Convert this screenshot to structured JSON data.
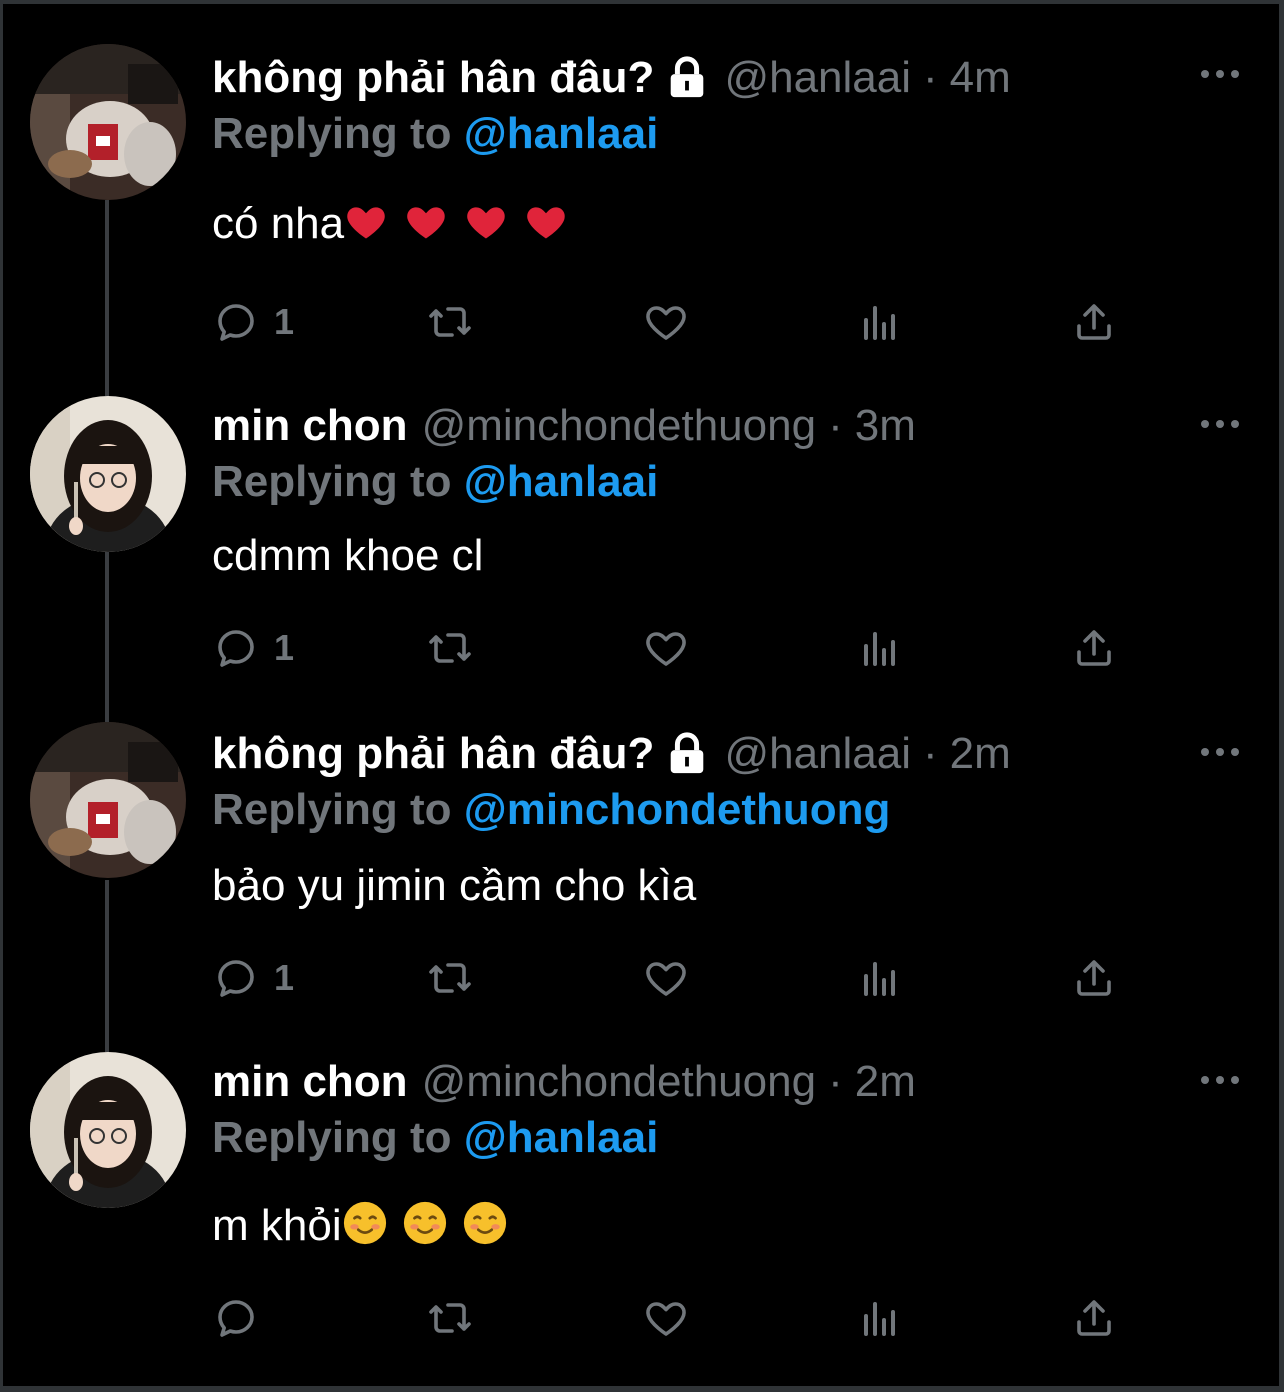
{
  "colors": {
    "background": "#000000",
    "name": "#ffffff",
    "muted": "#71767b",
    "link": "#1d9bf0",
    "thread_line": "#3a3d41"
  },
  "tweets": [
    {
      "display_name": "không phải hân đâu?",
      "protected": true,
      "handle": "@hanlaai",
      "dot": "·",
      "time": "4m",
      "reply_prefix": "Replying to",
      "reply_to": "@hanlaai",
      "text": "có nha",
      "emoji": [
        "red-heart",
        "red-heart",
        "red-heart",
        "red-heart"
      ],
      "reply_count": "1",
      "avatar": "hanlaai-avatar"
    },
    {
      "display_name": "min chon",
      "protected": false,
      "handle": "@minchondethuong",
      "dot": "·",
      "time": "3m",
      "reply_prefix": "Replying to",
      "reply_to": "@hanlaai",
      "text": "cdmm khoe cl",
      "emoji": [],
      "reply_count": "1",
      "avatar": "minchon-avatar"
    },
    {
      "display_name": "không phải hân đâu?",
      "protected": true,
      "handle": "@hanlaai",
      "dot": "·",
      "time": "2m",
      "reply_prefix": "Replying to",
      "reply_to": "@minchondethuong",
      "text": "bảo yu jimin cầm cho kìa",
      "emoji": [],
      "reply_count": "1",
      "avatar": "hanlaai-avatar"
    },
    {
      "display_name": "min chon",
      "protected": false,
      "handle": "@minchondethuong",
      "dot": "·",
      "time": "2m",
      "reply_prefix": "Replying to",
      "reply_to": "@hanlaai",
      "text": "m khỏi",
      "emoji": [
        "smiling-face",
        "smiling-face",
        "smiling-face"
      ],
      "reply_count": "",
      "avatar": "minchon-avatar"
    }
  ],
  "icons": {
    "reply": "reply-icon",
    "retweet": "retweet-icon",
    "like": "heart-icon",
    "views": "analytics-icon",
    "share": "share-icon",
    "more": "more-icon",
    "lock": "lock-icon"
  }
}
